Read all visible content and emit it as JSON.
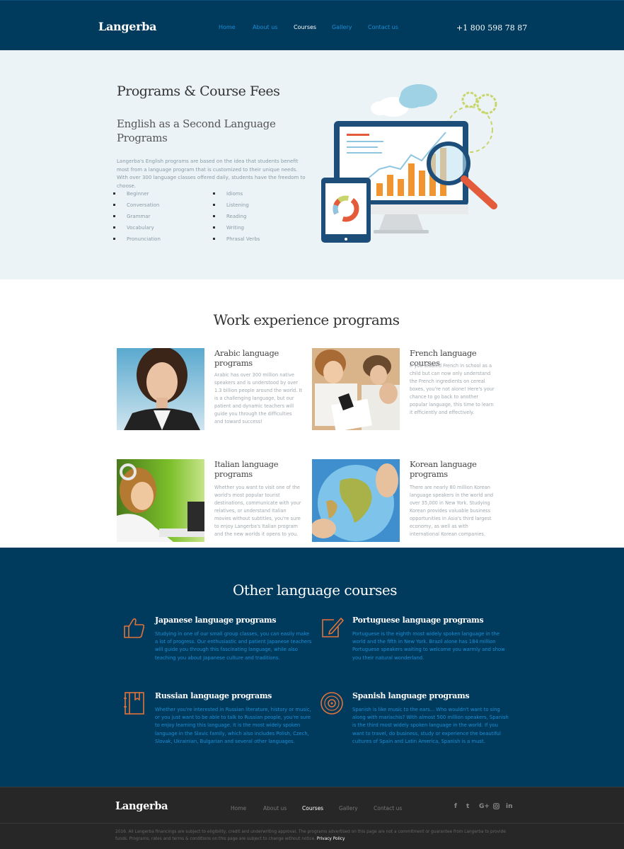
{
  "header": {
    "logo": "Langerba",
    "nav": [
      "Home",
      "About us",
      "Courses",
      "Gallery",
      "Contact us"
    ],
    "active_nav": "Courses",
    "phone": "+1 800 598 78 87"
  },
  "hero": {
    "title": "Programs & Course Fees",
    "subtitle": "English as a Second Language Programs",
    "description": "Langerba's English programs are based on the idea that students benefit most from a language program that is customized to their unique needs. With over 300 language classes offered daily, students have the freedom to choose.",
    "list_left": [
      "Beginner",
      "Conversation",
      "Grammar",
      "Vocabulary",
      "Pronunciation"
    ],
    "list_right": [
      "Idioms",
      "Listening",
      "Reading",
      "Writing",
      "Phrasal Verbs"
    ]
  },
  "work": {
    "title": "Work experience programs",
    "cards": [
      {
        "title": "Arabic language programs",
        "text": "Arabic has over 300 million native speakers and is understood by over 1.3 billion people around the world. It is a challenging language, but our patient and dynamic teachers will guide you through the difficulties and toward success!"
      },
      {
        "title": "French language courses",
        "text": "If you studied French in school as a child but can now only understand the French ingredients on cereal boxes, you're not alone! Here's your chance to go back to another popular language, this time to learn it efficiently and effectively."
      },
      {
        "title": "Italian language programs",
        "text": "Whether you want to visit one of the world's most popular tourist destinations, communicate with your relatives, or understand Italian movies without subtitles, you're sure to enjoy Langerba's Italian program and the new worlds it opens to you."
      },
      {
        "title": "Korean language programs",
        "text": "There are nearly 80 million Korean language speakers in the world and over 35,000 in New York. Studying Korean provides valuable business opportunities in Asia's third largest economy, as well as with international Korean companies."
      }
    ]
  },
  "other": {
    "title": "Other language courses",
    "courses": [
      {
        "icon": "thumbs-up-icon",
        "title": "Japanese language programs",
        "text": "Studying in one of our small group classes, you can easily make a lot of progress. Our enthusiastic and patient Japanese teachers will guide you through this fascinating language, while also teaching you about Japanese culture and traditions."
      },
      {
        "icon": "pencil-note-icon",
        "title": "Portuguese language programs",
        "text": "Portuguese is the eighth most widely spoken language in the world and the fifth in New York. Brazil alone has 184 million Portuguese speakers waiting to welcome you warmly and show you their natural wonderland."
      },
      {
        "icon": "book-icon",
        "title": "Russian language programs",
        "text": "Whether you're interested in Russian literature, history or music, or you just want to be able to talk to Russian people, you're sure to enjoy learning this language. It is the most widely spoken language in the Slavic family, which also includes Polish, Czech, Slovak, Ukrainian, Bulgarian and several other languages."
      },
      {
        "icon": "vinyl-record-icon",
        "title": "Spanish language programs",
        "text": "Spanish is like music to the ears... Who wouldn't want to sing along with mariachis? With almost 500 million speakers, Spanish is the third most widely spoken language in the world. If you want to travel, do business, study or experience the beautiful cultures of Spain and Latin America, Spanish is a must."
      }
    ]
  },
  "footer": {
    "logo": "Langerba",
    "nav": [
      "Home",
      "About us",
      "Courses",
      "Gallery",
      "Contact us"
    ],
    "active_nav": "Courses",
    "social": [
      "f",
      "t",
      "G+",
      "ig",
      "in"
    ],
    "legal": "2016. All Langerba financings are subject to eligibility, credit and underwriting approval. The programs advertised on this page are not a commitment or guarantee from Langerba to provide funds. Programs, rates and terms & conditions on this page are subject to change without notice.",
    "privacy": "Privacy Policy"
  },
  "colors": {
    "navy": "#003a5d",
    "link_blue": "#1a8fd6",
    "hero_bg": "#ebf3f6",
    "icon_orange": "#e2733a",
    "footer_bg": "#272727"
  }
}
